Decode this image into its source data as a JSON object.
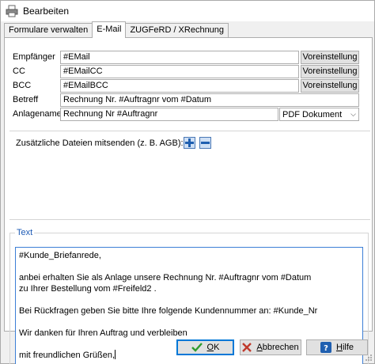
{
  "window": {
    "title": "Bearbeiten"
  },
  "tabs": [
    {
      "label": "Formulare verwalten",
      "active": false
    },
    {
      "label": "E-Mail",
      "active": true
    },
    {
      "label": "ZUGFeRD / XRechnung",
      "active": false
    }
  ],
  "form": {
    "empfaenger": {
      "label": "Empfänger",
      "value": "#EMail",
      "button": "Voreinstellung"
    },
    "cc": {
      "label": "CC",
      "value": "#EMailCC",
      "button": "Voreinstellung"
    },
    "bcc": {
      "label": "BCC",
      "value": "#EMailBCC",
      "button": "Voreinstellung"
    },
    "betreff": {
      "label": "Betreff",
      "value": "Rechnung Nr. #Auftragnr vom #Datum"
    },
    "anlagename": {
      "label": "Anlagename",
      "value": "Rechnung Nr #Auftragnr",
      "format": "PDF Dokument"
    }
  },
  "attachments": {
    "label": "Zusätzliche Dateien mitsenden (z. B. AGB):",
    "icons": [
      "add-file-icon",
      "remove-file-icon"
    ]
  },
  "text": {
    "legend": "Text",
    "lines": [
      "#Kunde_Briefanrede,",
      "",
      "anbei erhalten Sie als Anlage unsere Rechnung Nr. #Auftragnr vom #Datum",
      "zu Ihrer Bestellung vom #Freifeld2 .",
      "",
      "Bei Rückfragen geben Sie bitte Ihre folgende Kundennummer an: #Kunde_Nr",
      "",
      "Wir danken für Ihren Auftrag und verbleiben",
      "",
      "mit freundlichen Grüßen,"
    ]
  },
  "buttons": {
    "ok": {
      "underline": "O",
      "rest": "K"
    },
    "abbrechen": {
      "underline": "A",
      "rest": "bbrechen"
    },
    "hilfe": {
      "underline": "H",
      "rest": "ilfe"
    }
  },
  "colors": {
    "accent": "#0078d7",
    "legend": "#1e5bb5",
    "cancel_icon": "#c0392b"
  }
}
